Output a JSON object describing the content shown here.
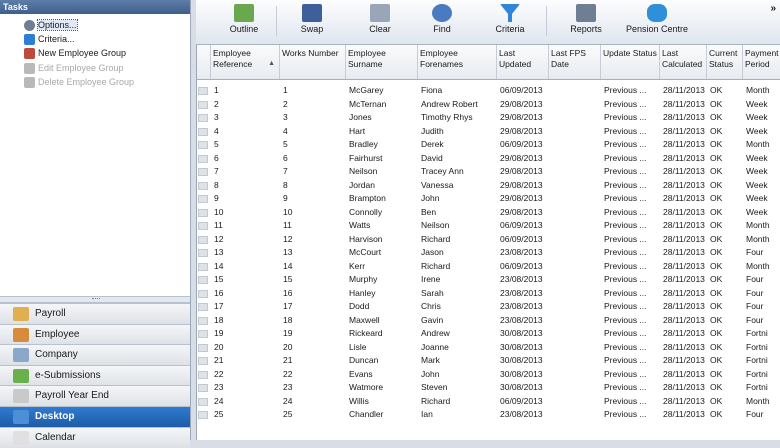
{
  "tasks": {
    "title": "Tasks",
    "items": [
      {
        "label": "Options...",
        "icon": "gear-icon",
        "enabled": true
      },
      {
        "label": "Criteria...",
        "icon": "funnel-icon",
        "enabled": true
      },
      {
        "label": "New Employee Group",
        "icon": "new-group-icon",
        "enabled": true
      },
      {
        "label": "Edit Employee Group",
        "icon": "edit-group-icon",
        "enabled": false
      },
      {
        "label": "Delete Employee Group",
        "icon": "delete-group-icon",
        "enabled": false
      }
    ]
  },
  "nav": [
    {
      "label": "Payroll",
      "icon": "payroll-icon",
      "color": "#e0b050"
    },
    {
      "label": "Employee",
      "icon": "employee-icon",
      "color": "#d88b3a"
    },
    {
      "label": "Company",
      "icon": "company-icon",
      "color": "#8da7c8"
    },
    {
      "label": "e-Submissions",
      "icon": "e-submissions-icon",
      "color": "#6ab04c"
    },
    {
      "label": "Payroll Year End",
      "icon": "pye-icon",
      "color": "#c9c9c9"
    },
    {
      "label": "Desktop",
      "icon": "desktop-icon",
      "color": "#4c8fd6",
      "active": true
    },
    {
      "label": "Calendar",
      "icon": "calendar-icon",
      "color": "#e0e0e0"
    }
  ],
  "toolbar": {
    "buttons": [
      {
        "label": "Outline",
        "icon": "outline-icon"
      },
      {
        "label": "Swap",
        "icon": "swap-icon"
      },
      {
        "label": "Clear",
        "icon": "clear-icon"
      },
      {
        "label": "Find",
        "icon": "find-icon"
      },
      {
        "label": "Criteria",
        "icon": "criteria-icon"
      },
      {
        "label": "Reports",
        "icon": "reports-icon"
      },
      {
        "label": "Pension Centre",
        "icon": "pension-centre-icon"
      }
    ],
    "overflow": "»"
  },
  "grid": {
    "columns": [
      "Employee Reference",
      "Works Number",
      "Employee Surname",
      "Employee Forenames",
      "Last Updated",
      "Last FPS Date",
      "Update Status",
      "Last Calculated",
      "Current Status",
      "Payment Period"
    ],
    "sort_indicator": "▲",
    "rows": [
      [
        "1",
        "1",
        "McGarey",
        "Fiona",
        "06/09/2013",
        "",
        "Previous ...",
        "28/11/2013",
        "OK",
        "Month"
      ],
      [
        "2",
        "2",
        "McTernan",
        "Andrew Robert",
        "29/08/2013",
        "",
        "Previous ...",
        "28/11/2013",
        "OK",
        "Week"
      ],
      [
        "3",
        "3",
        "Jones",
        "Timothy Rhys",
        "29/08/2013",
        "",
        "Previous ...",
        "28/11/2013",
        "OK",
        "Week"
      ],
      [
        "4",
        "4",
        "Hart",
        "Judith",
        "29/08/2013",
        "",
        "Previous ...",
        "28/11/2013",
        "OK",
        "Week"
      ],
      [
        "5",
        "5",
        "Bradley",
        "Derek",
        "06/09/2013",
        "",
        "Previous ...",
        "28/11/2013",
        "OK",
        "Month"
      ],
      [
        "6",
        "6",
        "Fairhurst",
        "David",
        "29/08/2013",
        "",
        "Previous ...",
        "28/11/2013",
        "OK",
        "Week"
      ],
      [
        "7",
        "7",
        "Neilson",
        "Tracey Ann",
        "29/08/2013",
        "",
        "Previous ...",
        "28/11/2013",
        "OK",
        "Week"
      ],
      [
        "8",
        "8",
        "Jordan",
        "Vanessa",
        "29/08/2013",
        "",
        "Previous ...",
        "28/11/2013",
        "OK",
        "Week"
      ],
      [
        "9",
        "9",
        "Brampton",
        "John",
        "29/08/2013",
        "",
        "Previous ...",
        "28/11/2013",
        "OK",
        "Week"
      ],
      [
        "10",
        "10",
        "Connolly",
        "Ben",
        "29/08/2013",
        "",
        "Previous ...",
        "28/11/2013",
        "OK",
        "Week"
      ],
      [
        "11",
        "11",
        "Watts",
        "Neilson",
        "06/09/2013",
        "",
        "Previous ...",
        "28/11/2013",
        "OK",
        "Month"
      ],
      [
        "12",
        "12",
        "Harvison",
        "Richard",
        "06/09/2013",
        "",
        "Previous ...",
        "28/11/2013",
        "OK",
        "Month"
      ],
      [
        "13",
        "13",
        "McCourt",
        "Jason",
        "23/08/2013",
        "",
        "Previous ...",
        "28/11/2013",
        "OK",
        "Four"
      ],
      [
        "14",
        "14",
        "Kerr",
        "Richard",
        "06/09/2013",
        "",
        "Previous ...",
        "28/11/2013",
        "OK",
        "Month"
      ],
      [
        "15",
        "15",
        "Murphy",
        "Irene",
        "23/08/2013",
        "",
        "Previous ...",
        "28/11/2013",
        "OK",
        "Four"
      ],
      [
        "16",
        "16",
        "Hanley",
        "Sarah",
        "23/08/2013",
        "",
        "Previous ...",
        "28/11/2013",
        "OK",
        "Four"
      ],
      [
        "17",
        "17",
        "Dodd",
        "Chris",
        "23/08/2013",
        "",
        "Previous ...",
        "28/11/2013",
        "OK",
        "Four"
      ],
      [
        "18",
        "18",
        "Maxwell",
        "Gavin",
        "23/08/2013",
        "",
        "Previous ...",
        "28/11/2013",
        "OK",
        "Four"
      ],
      [
        "19",
        "19",
        "Rickeard",
        "Andrew",
        "30/08/2013",
        "",
        "Previous ...",
        "28/11/2013",
        "OK",
        "Fortni"
      ],
      [
        "20",
        "20",
        "Lisle",
        "Joanne",
        "30/08/2013",
        "",
        "Previous ...",
        "28/11/2013",
        "OK",
        "Fortni"
      ],
      [
        "21",
        "21",
        "Duncan",
        "Mark",
        "30/08/2013",
        "",
        "Previous ...",
        "28/11/2013",
        "OK",
        "Fortni"
      ],
      [
        "22",
        "22",
        "Evans",
        "John",
        "30/08/2013",
        "",
        "Previous ...",
        "28/11/2013",
        "OK",
        "Fortni"
      ],
      [
        "23",
        "23",
        "Watmore",
        "Steven",
        "30/08/2013",
        "",
        "Previous ...",
        "28/11/2013",
        "OK",
        "Fortni"
      ],
      [
        "24",
        "24",
        "Willis",
        "Richard",
        "06/09/2013",
        "",
        "Previous ...",
        "28/11/2013",
        "OK",
        "Month"
      ],
      [
        "25",
        "25",
        "Chandler",
        "Ian",
        "23/08/2013",
        "",
        "Previous ...",
        "28/11/2013",
        "OK",
        "Four"
      ]
    ]
  }
}
